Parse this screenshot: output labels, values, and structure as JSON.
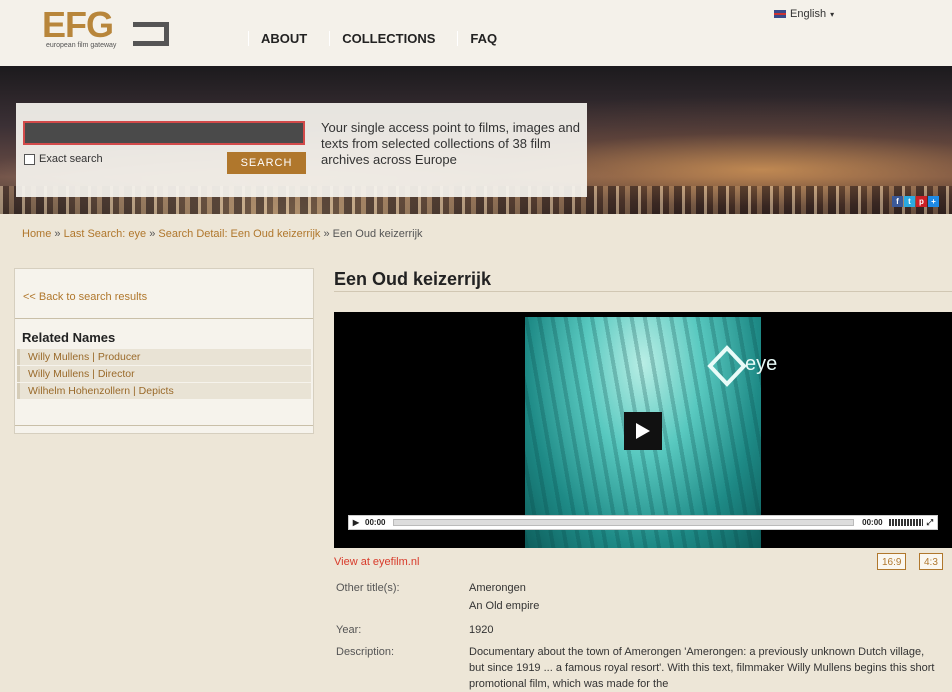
{
  "header": {
    "logo_text": "EFG",
    "logo_sub": "european film gateway",
    "nav": [
      "ABOUT",
      "COLLECTIONS",
      "FAQ"
    ],
    "language": "English"
  },
  "search": {
    "value": "",
    "exact_label": "Exact search",
    "button_label": "SEARCH",
    "tagline": "Your single access point to films, images and texts from selected collections of 38 film archives across Europe"
  },
  "share_icons": [
    "f",
    "t",
    "p",
    "+"
  ],
  "breadcrumb": {
    "home": "Home",
    "sep": "»",
    "last_search": "Last Search: eye",
    "detail": "Search Detail: Een Oud keizerrijk",
    "current": "Een Oud keizerrijk"
  },
  "left": {
    "back": "<< Back to search results",
    "related_title": "Related Names",
    "related": [
      "Willy Mullens | Producer",
      "Willy Mullens | Director",
      "Wilhelm Hohenzollern | Depicts"
    ]
  },
  "main": {
    "title": "Een Oud keizerrijk",
    "video": {
      "watermark": "eye",
      "time_current": "00:00",
      "time_total": "00:00"
    },
    "view_link": "View at eyefilm.nl",
    "aspect": [
      "16:9",
      "4:3"
    ],
    "meta": {
      "other_titles_label": "Other title(s):",
      "other_titles": [
        "Amerongen",
        "An Old empire"
      ],
      "year_label": "Year:",
      "year": "1920",
      "description_label": "Description:",
      "description": "Documentary about the town of Amerongen 'Amerongen: a previously unknown Dutch village, but since 1919 ... a famous royal resort'. With this text, filmmaker Willy Mullens begins this short promotional film, which was made for the"
    }
  },
  "colors": {
    "accent": "#b0772c",
    "link_red": "#d83a2a",
    "background": "#ede6d7"
  }
}
